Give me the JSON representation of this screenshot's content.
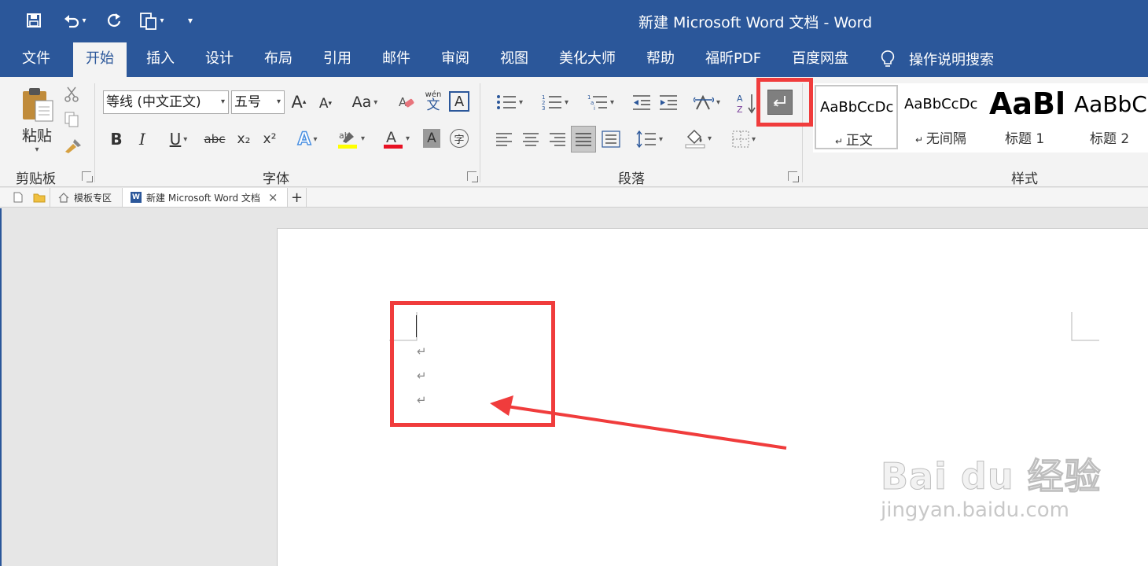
{
  "window": {
    "title": "新建 Microsoft Word 文档  -  Word"
  },
  "tabs": [
    "文件",
    "开始",
    "插入",
    "设计",
    "布局",
    "引用",
    "邮件",
    "审阅",
    "视图",
    "美化大师",
    "帮助",
    "福昕PDF",
    "百度网盘"
  ],
  "active_tab": "开始",
  "tell_me": "操作说明搜索",
  "clipboard": {
    "paste_label": "粘贴",
    "group_label": "剪贴板"
  },
  "font": {
    "font_name": "等线 (中文正文)",
    "font_size": "五号",
    "group_label": "字体",
    "change_case": "Aa",
    "pinyin_top": "wén",
    "pinyin_char": "文",
    "strike": "abc",
    "sub": "x₂",
    "sup": "x²",
    "enclose": "字"
  },
  "paragraph": {
    "group_label": "段落"
  },
  "styles": {
    "group_label": "样式",
    "items": [
      {
        "sample": "AaBbCcDc",
        "name": "正文"
      },
      {
        "sample": "AaBbCcDc",
        "name": "无间隔"
      },
      {
        "sample": "AaBl",
        "name": "标题 1"
      },
      {
        "sample": "AaBbC",
        "name": "标题 2"
      }
    ]
  },
  "doc_tabs": {
    "template": "模板专区",
    "document": "新建 Microsoft Word 文档"
  },
  "document": {
    "paragraph_marks": [
      "↵",
      "↵",
      "↵"
    ]
  },
  "watermark": {
    "brand": "Bai du 经验",
    "url": "jingyan.baidu.com"
  },
  "colors": {
    "brand": "#2b579a",
    "highlight": "#f03c3c",
    "ribbon": "#f3f3f3"
  }
}
